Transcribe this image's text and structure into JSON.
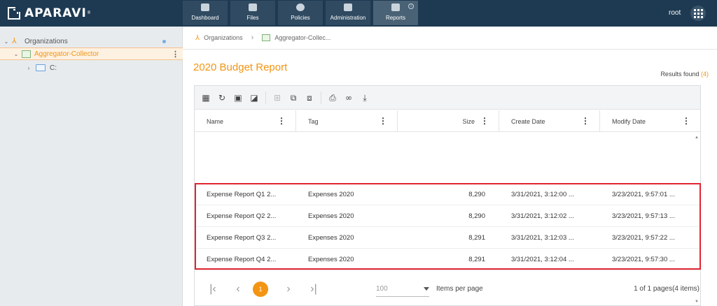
{
  "app": {
    "logo_text": "APARAVI",
    "logo_mark": "®",
    "user": "root"
  },
  "nav": [
    {
      "label": "Dashboard",
      "icon": "dashboard-icon"
    },
    {
      "label": "Files",
      "icon": "folder-icon"
    },
    {
      "label": "Policies",
      "icon": "gear-icon"
    },
    {
      "label": "Administration",
      "icon": "users-icon"
    },
    {
      "label": "Reports",
      "icon": "clipboard-icon",
      "active": true
    }
  ],
  "sidebar": {
    "items": [
      {
        "label": "Organizations"
      },
      {
        "label": "Aggregator-Collector",
        "selected": true
      },
      {
        "label": "C:"
      }
    ]
  },
  "breadcrumb": {
    "items": [
      "Organizations",
      "Aggregator-Collec..."
    ]
  },
  "report": {
    "title": "2020 Budget Report",
    "results_label": "Results found",
    "results_count": "(4)"
  },
  "table": {
    "columns": [
      "Name",
      "Tag",
      "Size",
      "Create Date",
      "Modify Date"
    ],
    "rows": [
      [
        "Expense Report Q1 2...",
        "Expenses 2020",
        "8,290",
        "3/31/2021, 3:12:00 ...",
        "3/23/2021, 9:57:01 ..."
      ],
      [
        "Expense Report Q2 2...",
        "Expenses 2020",
        "8,290",
        "3/31/2021, 3:12:02 ...",
        "3/23/2021, 9:57:13 ..."
      ],
      [
        "Expense Report Q3 2...",
        "Expenses 2020",
        "8,291",
        "3/31/2021, 3:12:03 ...",
        "3/23/2021, 9:57:22 ..."
      ],
      [
        "Expense Report Q4 2...",
        "Expenses 2020",
        "8,291",
        "3/31/2021, 3:12:04 ...",
        "3/23/2021, 9:57:30 ..."
      ]
    ]
  },
  "pager": {
    "current_page": "1",
    "per_page": "100",
    "per_page_label": "Items per page",
    "info": "1 of 1 pages(4 items)"
  },
  "colors": {
    "accent": "#f39512",
    "topbar": "#1e3a52",
    "highlight": "#e0252f"
  }
}
